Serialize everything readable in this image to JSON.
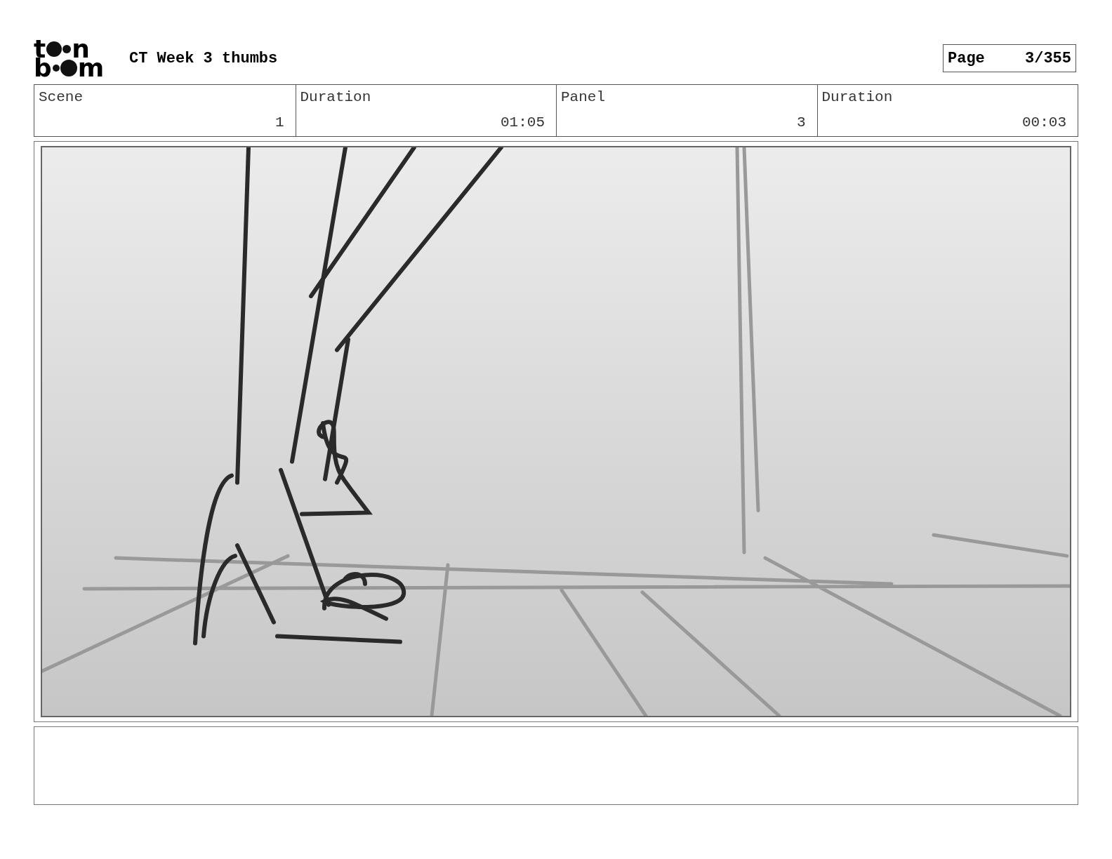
{
  "logo": {
    "line_1": [
      "t",
      "n"
    ],
    "line_2": [
      "b",
      "m"
    ]
  },
  "title": "CT Week 3 thumbs",
  "page": {
    "label": "Page",
    "value": "3/355"
  },
  "info": [
    {
      "label": "Scene",
      "value": "1"
    },
    {
      "label": "Duration",
      "value": "01:05"
    },
    {
      "label": "Panel",
      "value": "3"
    },
    {
      "label": "Duration",
      "value": "00:03"
    }
  ],
  "panel": {
    "kind": "sketch"
  }
}
